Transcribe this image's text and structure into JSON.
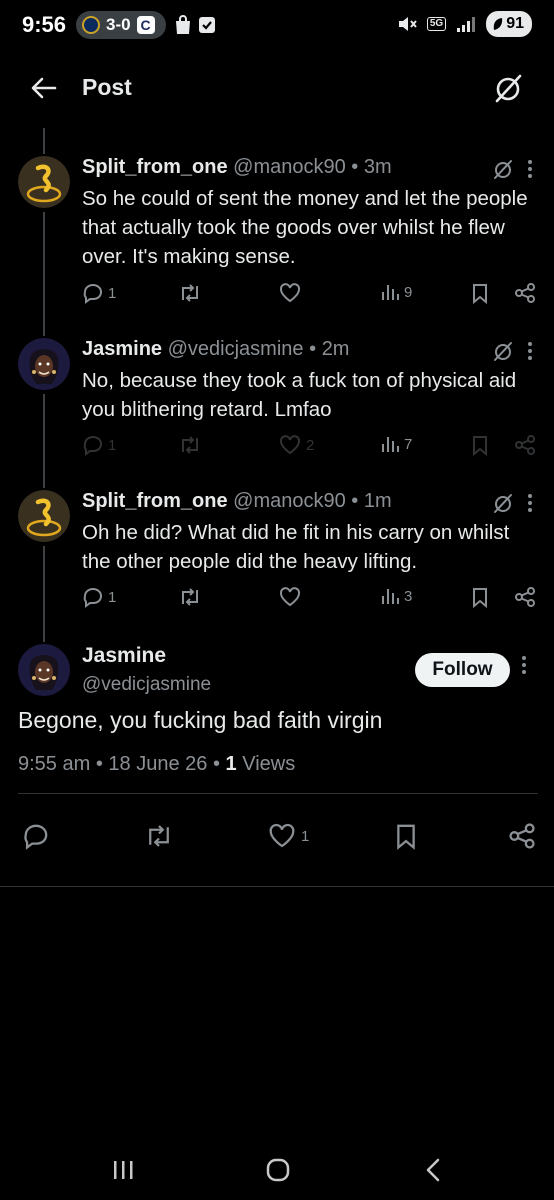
{
  "status_bar": {
    "time": "9:56",
    "score": "3-0",
    "team_b_letter": "C",
    "network": "5G",
    "battery": "91"
  },
  "header": {
    "title": "Post"
  },
  "replies": [
    {
      "name": "Split_from_one",
      "handle": "@manock90",
      "time": "3m",
      "text": "So he could of sent the money and let the people that actually took the goods over whilst he flew over. It's making sense.",
      "replies": "1",
      "retweets": "",
      "likes": "",
      "views": "9"
    },
    {
      "name": "Jasmine",
      "handle": "@vedicjasmine",
      "time": "2m",
      "text": "No, because they took a fuck ton of physical aid you blithering retard. Lmfao",
      "replies": "1",
      "retweets": "",
      "likes": "2",
      "views": "7"
    },
    {
      "name": "Split_from_one",
      "handle": "@manock90",
      "time": "1m",
      "text": "Oh he did? What did he fit in his carry on whilst the other people did the heavy lifting.",
      "replies": "1",
      "retweets": "",
      "likes": "",
      "views": "3"
    }
  ],
  "main_post": {
    "name": "Jasmine",
    "handle": "@vedicjasmine",
    "follow_label": "Follow",
    "text": "Begone, you fucking bad faith virgin",
    "time": "9:55 am",
    "date": "18 June 26",
    "views_count": "1",
    "views_label": "Views",
    "likes": "1"
  },
  "colors": {
    "background": "#000000",
    "text_primary": "#e7e9ea",
    "text_secondary": "#8b9095",
    "divider": "#2f3336",
    "follow_bg": "#eff3f4"
  },
  "icons": [
    "back-arrow-icon",
    "grok-icon",
    "more-icon",
    "reply-icon",
    "retweet-icon",
    "like-icon",
    "views-icon",
    "bookmark-icon",
    "share-icon"
  ]
}
